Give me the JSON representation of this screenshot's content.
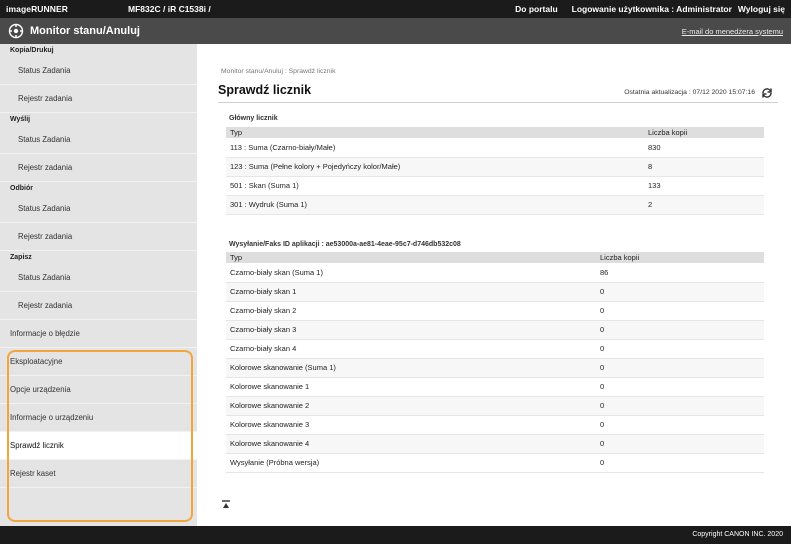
{
  "topbar": {
    "brand": "imageRUNNER",
    "model": "MF832C / iR C1538i /",
    "portal": "Do portalu",
    "login": "Logowanie użytkownika : Administrator",
    "logout": "Wyloguj się"
  },
  "header": {
    "title": "Monitor stanu/Anuluj",
    "mail": "E-mail do menedżera systemu"
  },
  "sidebar": {
    "sections": [
      {
        "heading": "Kopia/Drukuj",
        "items": [
          "Status Zadania",
          "Rejestr zadania"
        ]
      },
      {
        "heading": "Wyślij",
        "items": [
          "Status Zadania",
          "Rejestr zadania"
        ]
      },
      {
        "heading": "Odbiór",
        "items": [
          "Status Zadania",
          "Rejestr zadania"
        ]
      },
      {
        "heading": "Zapisz",
        "items": [
          "Status Zadania",
          "Rejestr zadania"
        ]
      }
    ],
    "bottom_items": [
      "Informacje o błędzie",
      "Eksploatacyjne",
      "Opcje urządzenia",
      "Informacje o urządzeniu",
      "Sprawdź licznik",
      "Rejestr kaset"
    ],
    "active_item": "Sprawdź licznik",
    "highlight_color": "#f1a53b"
  },
  "main": {
    "breadcrumb": "Monitor stanu/Anuluj : Sprawdź licznik",
    "title": "Sprawdź licznik",
    "last_update": "Ostatnia aktualizacja : 07/12 2020 15:07:16",
    "main_counter": {
      "title": "Główny licznik",
      "col_type": "Typ",
      "col_count": "Liczba kopii",
      "rows": [
        {
          "type": "113 : Suma (Czarno-biały/Małe)",
          "count": "830"
        },
        {
          "type": "123 : Suma (Pełne kolory + Pojedyńczy kolor/Małe)",
          "count": "8"
        },
        {
          "type": "501 : Skan (Suma 1)",
          "count": "133"
        },
        {
          "type": "301 : Wydruk (Suma 1)",
          "count": "2"
        }
      ]
    },
    "app_counter": {
      "title": "Wysyłanie/Faks ID aplikacji : ae53000a-ae81-4eae-95c7-d746db532c08",
      "col_type": "Typ",
      "col_count": "Liczba kopii",
      "rows": [
        {
          "type": "Czarno-biały skan (Suma 1)",
          "count": "86"
        },
        {
          "type": "Czarno-biały skan 1",
          "count": "0"
        },
        {
          "type": "Czarno-biały skan 2",
          "count": "0"
        },
        {
          "type": "Czarno-biały skan 3",
          "count": "0"
        },
        {
          "type": "Czarno-biały skan 4",
          "count": "0"
        },
        {
          "type": "Kolorowe skanowanie (Suma 1)",
          "count": "0"
        },
        {
          "type": "Kolorowe skanowanie 1",
          "count": "0"
        },
        {
          "type": "Kolorowe skanowanie 2",
          "count": "0"
        },
        {
          "type": "Kolorowe skanowanie 3",
          "count": "0"
        },
        {
          "type": "Kolorowe skanowanie 4",
          "count": "0"
        },
        {
          "type": "Wysyłanie (Próbna wersja)",
          "count": "0"
        }
      ]
    },
    "to_top_icon": "to-top-icon"
  },
  "footer": {
    "copyright": "Copyright CANON INC. 2020"
  }
}
